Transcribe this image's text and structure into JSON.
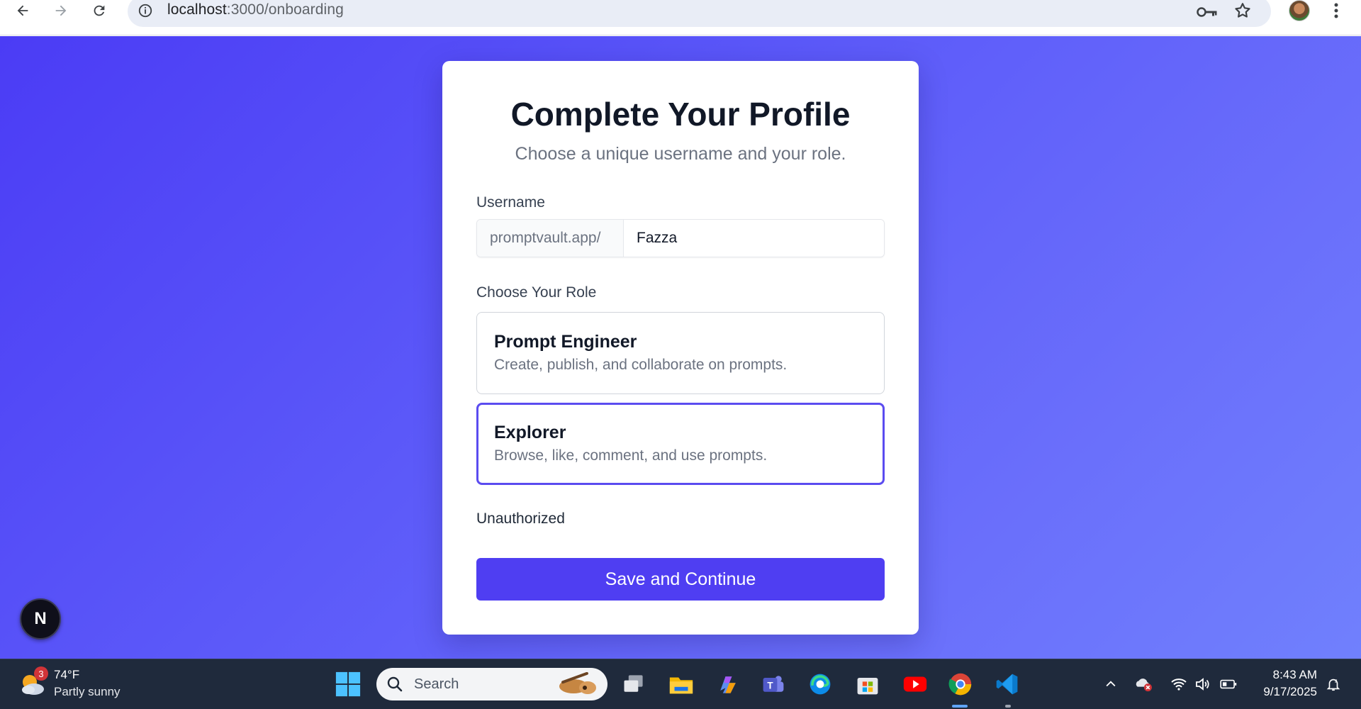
{
  "browser": {
    "url_host": "localhost",
    "url_path": ":3000/onboarding"
  },
  "page": {
    "title": "Complete Your Profile",
    "subtitle": "Choose a unique username and your role.",
    "username": {
      "label": "Username",
      "prefix": "promptvault.app/",
      "value": "Fazza"
    },
    "role": {
      "label": "Choose Your Role",
      "options": [
        {
          "title": "Prompt Engineer",
          "description": "Create, publish, and collaborate on prompts.",
          "selected": false
        },
        {
          "title": "Explorer",
          "description": "Browse, like, comment, and use prompts.",
          "selected": true
        }
      ]
    },
    "status": "Unauthorized",
    "submit_label": "Save and Continue",
    "dev_badge": "N"
  },
  "taskbar": {
    "weather_temp": "74°F",
    "weather_desc": "Partly sunny",
    "weather_badge": "3",
    "search_placeholder": "Search",
    "time": "8:43 AM",
    "date": "9/17/2025"
  },
  "colors": {
    "accent": "#4f3ef2",
    "selected_border": "#5b4cf0",
    "background_gradient_start": "#4b3cf5",
    "background_gradient_end": "#7080fd"
  }
}
